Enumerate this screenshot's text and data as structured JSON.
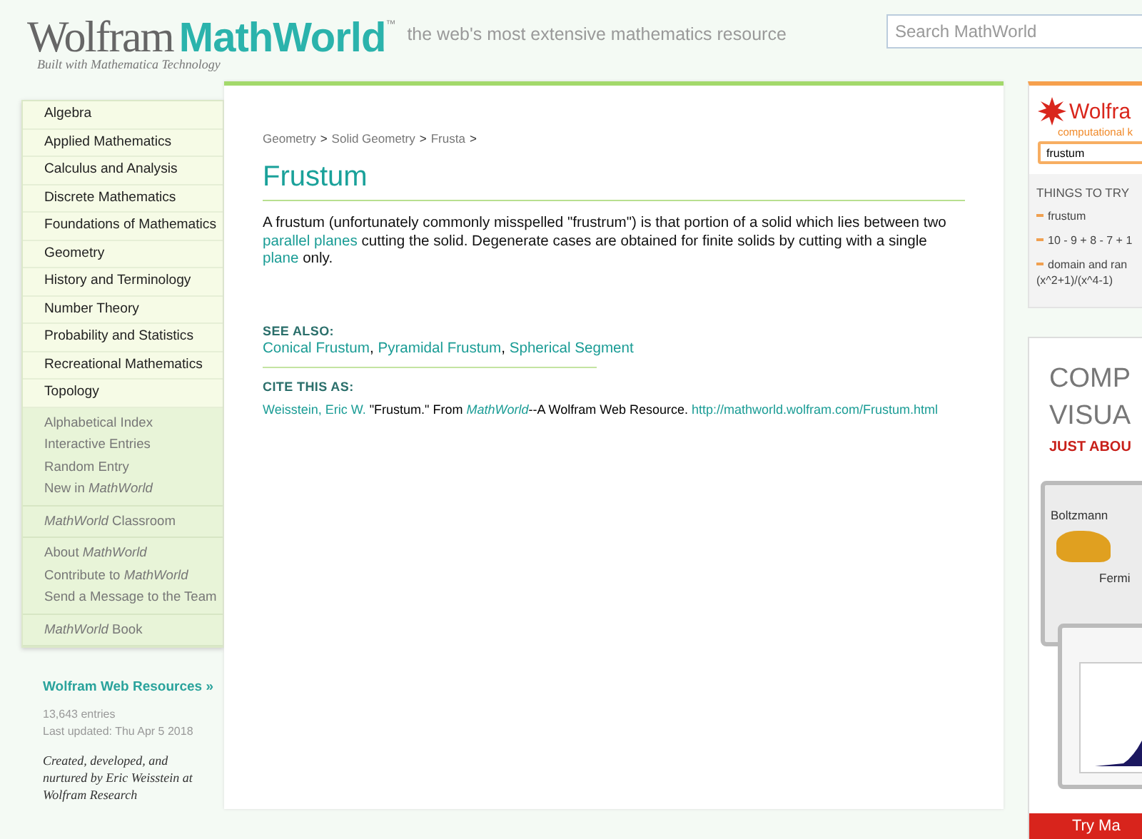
{
  "header": {
    "logo_word": "Wolfram",
    "logo_brand": "MathWorld",
    "logo_tm": "™",
    "logo_sub": "Built with Mathematica Technology",
    "tagline": "the web's most extensive mathematics resource",
    "search": {
      "placeholder": "Search MathWorld"
    }
  },
  "nav": {
    "categories": [
      "Algebra",
      "Applied Mathematics",
      "Calculus and Analysis",
      "Discrete Mathematics",
      "Foundations of Mathematics",
      "Geometry",
      "History and Terminology",
      "Number Theory",
      "Probability and Statistics",
      "Recreational Mathematics",
      "Topology"
    ],
    "groups": [
      [
        "Alphabetical Index",
        "Interactive Entries",
        "Random Entry",
        "New in *MathWorld*"
      ],
      [
        "*MathWorld* Classroom"
      ],
      [
        "About *MathWorld*",
        "Contribute to *MathWorld*",
        "Send a Message to the Team"
      ],
      [
        "*MathWorld* Book"
      ]
    ],
    "resources": "Wolfram Web Resources »",
    "entries": "13,643 entries",
    "updated": "Last updated: Thu Apr 5 2018",
    "credit": "Created, developed, and nurtured by Eric Weisstein at Wolfram Research"
  },
  "article": {
    "breadcrumbs": [
      "Geometry",
      ">",
      "Solid Geometry",
      ">",
      "Frusta",
      ">"
    ],
    "title": "Frustum",
    "body": [
      {
        "kind": "text",
        "text": "A frustum (unfortunately commonly misspelled \"frustrum\") is that portion of a solid which lies between two "
      },
      {
        "kind": "link",
        "text": "parallel planes"
      },
      {
        "kind": "text",
        "text": " cutting the solid. Degenerate cases are obtained for finite solids by cutting with a single "
      },
      {
        "kind": "link",
        "text": "plane"
      },
      {
        "kind": "text",
        "text": " only."
      }
    ],
    "see_also_heading": "SEE ALSO:",
    "see_also": [
      {
        "kind": "link",
        "text": "Conical Frustum"
      },
      {
        "kind": "text",
        "text": ", "
      },
      {
        "kind": "link",
        "text": "Pyramidal Frustum"
      },
      {
        "kind": "text",
        "text": ", "
      },
      {
        "kind": "link",
        "text": "Spherical Segment"
      }
    ],
    "cite_heading": "CITE THIS AS:",
    "cite": [
      {
        "kind": "link",
        "text": "Weisstein, Eric W."
      },
      {
        "kind": "text",
        "text": " \"Frustum.\" From "
      },
      {
        "kind": "link",
        "text": "*MathWorld*"
      },
      {
        "kind": "text",
        "text": "--A Wolfram Web Resource. "
      },
      {
        "kind": "link",
        "text": "http://mathworld.wolfram.com/Frustum.html"
      }
    ]
  },
  "alpha": {
    "logo": "Wolfra",
    "sub": "computational k",
    "input": "frustum",
    "heading": "THINGS TO TRY",
    "items": [
      "frustum",
      "10 - 9 + 8 - 7 + 1",
      "domain and ran (x^2+1)/(x^4-1)"
    ]
  },
  "ad": {
    "line1": "COMP",
    "line2": "VISUA",
    "tagline": "JUST ABOU",
    "label1": "Boltzmann",
    "label2": "Fermi",
    "button": "Try Ma"
  }
}
